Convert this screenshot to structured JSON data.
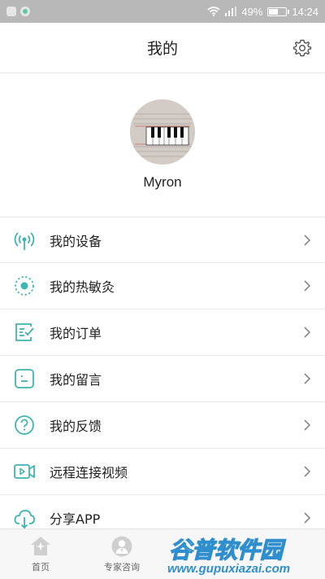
{
  "status_bar": {
    "battery": "49%",
    "time": "14:24",
    "battery_level": 0.49
  },
  "header": {
    "title": "我的",
    "settings_icon": "gear-icon"
  },
  "profile": {
    "username": "Myron"
  },
  "menu": [
    {
      "label": "我的设备",
      "icon": "broadcast-icon"
    },
    {
      "label": "我的热敏灸",
      "icon": "target-dot-icon"
    },
    {
      "label": "我的订单",
      "icon": "order-list-icon"
    },
    {
      "label": "我的留言",
      "icon": "message-icon"
    },
    {
      "label": "我的反馈",
      "icon": "question-icon"
    },
    {
      "label": "远程连接视频",
      "icon": "video-icon"
    },
    {
      "label": "分享APP",
      "icon": "cloud-share-icon"
    }
  ],
  "bottom_nav": [
    {
      "label": "首页",
      "icon": "home-icon"
    },
    {
      "label": "专家咨询",
      "icon": "doctor-icon"
    }
  ],
  "watermark": {
    "title": "谷普软件园",
    "url": "www.gupuxiazai.com"
  },
  "colors": {
    "accent": "#3fb5b0",
    "status_bar": "#b8b8b8"
  }
}
